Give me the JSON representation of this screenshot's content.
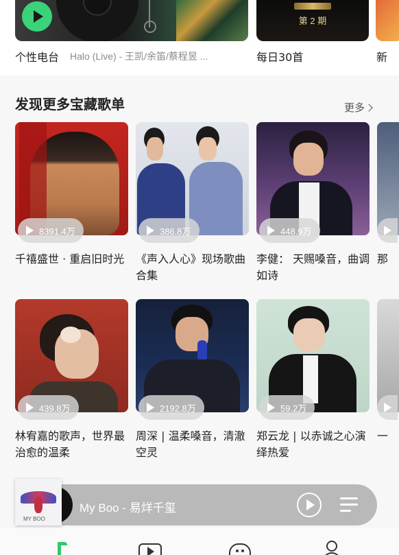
{
  "top_row": {
    "radio": {
      "label": "个性电台",
      "subtitle": "Halo (Live) - 王凯/余笛/蔡程昱 ..."
    },
    "daily": {
      "label": "每日30首",
      "issue": "第 2 期"
    },
    "new": {
      "label": "新"
    }
  },
  "section": {
    "title": "发现更多宝藏歌单",
    "more_label": "更多"
  },
  "playlists": [
    {
      "title": "千禧盛世 · 重启旧时光",
      "play_count": "8391.4万"
    },
    {
      "title": "《声入人心》现场歌曲合集",
      "play_count": "386.8万"
    },
    {
      "title": "李健： 天赐嗓音，曲调如诗",
      "play_count": "448.9万"
    },
    {
      "title": "林宥嘉的歌声，世界最治愈的温柔",
      "play_count": "439.8万"
    },
    {
      "title": "周深 | 温柔嗓音，清澈空灵",
      "play_count": "2192.8万"
    },
    {
      "title": "郑云龙 | 以赤诚之心演绎热爱",
      "play_count": "59.2万"
    }
  ],
  "edge_titles": [
    "那",
    "一"
  ],
  "player": {
    "now_playing": "My Boo - 易烊千玺",
    "album_tag": "MY BOO"
  },
  "colors": {
    "accent_green": "#35c86b",
    "player_bg": "#b9b9b9"
  },
  "icons": {
    "radio_play": "play-icon",
    "more": "chevron-right-icon",
    "count": "play-triangle-icon",
    "player_play": "play-circle-icon",
    "playlist": "playlist-icon",
    "nav": [
      "music-note-icon",
      "video-icon",
      "community-icon",
      "profile-icon"
    ]
  }
}
